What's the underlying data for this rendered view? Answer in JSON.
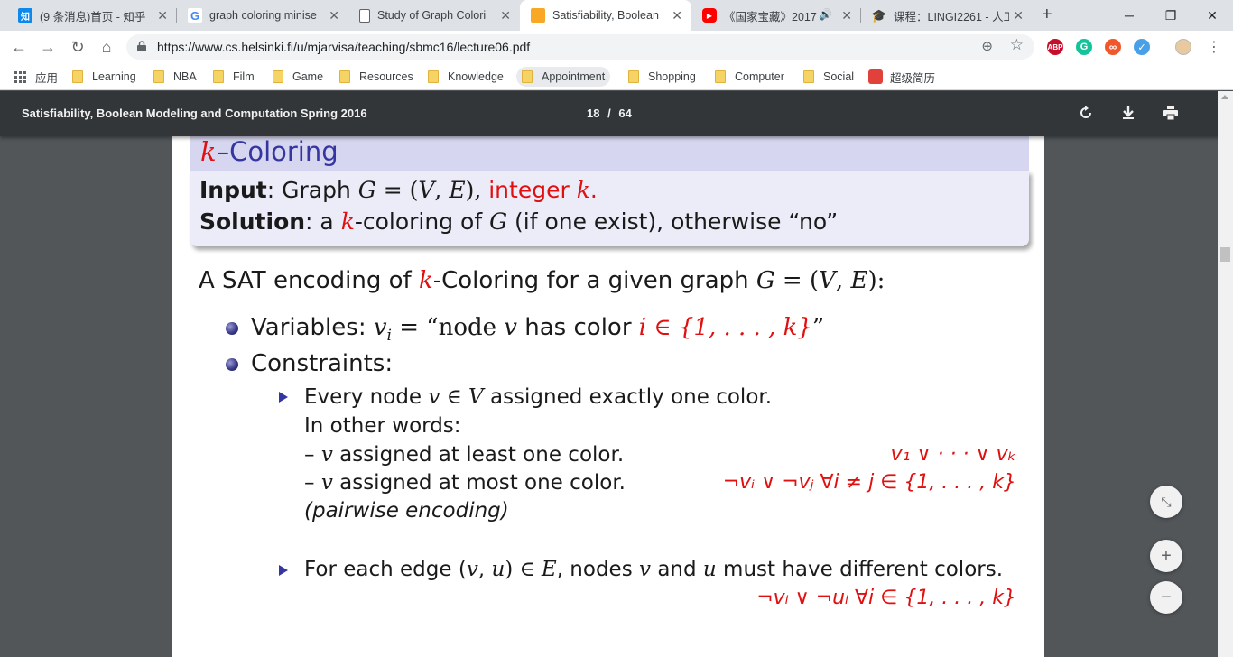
{
  "tabs": [
    {
      "title": "(9 条消息)首页 - 知乎",
      "favicon": "zhihu-icon",
      "active": false
    },
    {
      "title": "graph coloring minise",
      "favicon": "google-icon",
      "active": false
    },
    {
      "title": "Study of Graph Colori",
      "favicon": "document-icon",
      "active": false
    },
    {
      "title": "Satisfiability, Boolean",
      "favicon": "orange-square-icon",
      "active": true
    },
    {
      "title": "《国家宝藏》2017",
      "favicon": "youtube-icon",
      "active": false
    },
    {
      "title": "课程：LINGI2261 - 人工",
      "favicon": "graduation-cap-icon",
      "active": false
    }
  ],
  "toolbar": {
    "url": "https://www.cs.helsinki.fi/u/mjarvisa/teaching/sbmc16/lecture06.pdf",
    "extensions": [
      {
        "name": "adblock-icon",
        "label": "ABP",
        "color": "#c70d2c"
      },
      {
        "name": "grammarly-icon",
        "label": "G",
        "color": "#15c39a"
      },
      {
        "name": "infinity-icon",
        "label": "∞",
        "color": "#f0572a"
      },
      {
        "name": "vpn-icon",
        "label": "✓",
        "color": "#4aa0e6"
      }
    ]
  },
  "bookmarks": [
    {
      "label": "应用",
      "type": "apps"
    },
    {
      "label": "Learning",
      "type": "folder"
    },
    {
      "label": "NBA",
      "type": "folder"
    },
    {
      "label": "Film",
      "type": "folder"
    },
    {
      "label": "Game",
      "type": "folder"
    },
    {
      "label": "Resources",
      "type": "folder"
    },
    {
      "label": "Knowledge",
      "type": "folder"
    },
    {
      "label": "Appointment",
      "type": "folder"
    },
    {
      "label": "Shopping",
      "type": "folder"
    },
    {
      "label": "Computer",
      "type": "folder"
    },
    {
      "label": "Social",
      "type": "folder"
    },
    {
      "label": "超级简历",
      "type": "site"
    }
  ],
  "pdf": {
    "title": "Satisfiability, Boolean Modeling and Computation Spring 2016",
    "current_page": "18",
    "page_sep": "/",
    "total_pages": "64"
  },
  "slide": {
    "block_title_k": "k",
    "block_title_rest": "–Coloring",
    "input_label": "Input",
    "input_text": ": Graph ",
    "input_G": "G",
    "input_eq": " = (",
    "input_V": "V",
    "input_comma": ", ",
    "input_E": "E",
    "input_close": "), ",
    "input_integer": "integer ",
    "input_k": "k",
    "input_dot": ".",
    "solution_label": "Solution",
    "solution_a": ": a ",
    "solution_k": "k",
    "solution_rest1": "-coloring of ",
    "solution_G": "G",
    "solution_rest2": " (if one exist), otherwise “no”",
    "intro_a": "A SAT encoding of ",
    "intro_k": "k",
    "intro_b": "-Coloring for a given graph ",
    "intro_G": "G",
    "intro_eq": " = (",
    "intro_V": "V",
    "intro_comma": ", ",
    "intro_E": "E",
    "intro_close": "):",
    "vars_label": "Variables: ",
    "vars_v": "v",
    "vars_i": "i",
    "vars_eq": " = “node ",
    "vars_v2": "v",
    "vars_has": " has color ",
    "vars_set": "i ∈ {1, . . . , k}",
    "vars_end": "”",
    "constraints_label": "Constraints:",
    "c1_a": "Every node ",
    "c1_v": "v",
    "c1_in": " ∈ ",
    "c1_V": "V",
    "c1_b": " assigned exactly one color.",
    "c1_other": "In other words:",
    "c1_least_a": "– ",
    "c1_least_v": "v",
    "c1_least_b": " assigned at least one color.",
    "c1_least_formula": "v₁ ∨ · · · ∨ vₖ",
    "c1_most_a": "– ",
    "c1_most_v": "v",
    "c1_most_b": " assigned at most one color.",
    "c1_most_formula": "¬vᵢ ∨ ¬vⱼ ∀i ≠ j ∈ {1, . . . , k}",
    "c1_pairwise": "(pairwise encoding)",
    "c2_a": "For each edge (",
    "c2_v": "v",
    "c2_comma": ", ",
    "c2_u": "u",
    "c2_in": ") ∈ ",
    "c2_E": "E",
    "c2_b": ", nodes ",
    "c2_v2": "v",
    "c2_and": " and ",
    "c2_u2": "u",
    "c2_c": " must have different colors.",
    "c2_formula": "¬vᵢ ∨ ¬uᵢ ∀i ∈ {1, . . . , k}"
  },
  "zoom_controls": {
    "fit": "fit-to-page-icon",
    "zoom_in": "+",
    "zoom_out": "−"
  }
}
